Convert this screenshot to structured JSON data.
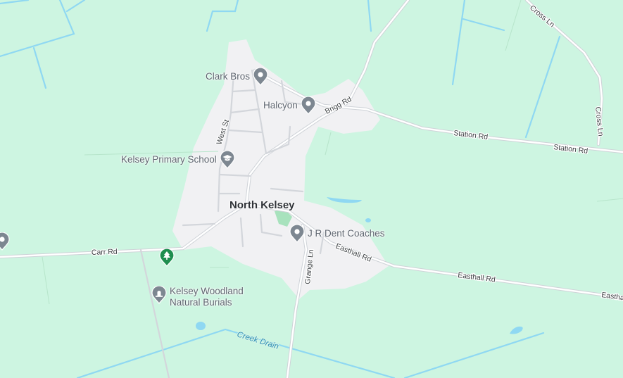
{
  "map": {
    "place": "North Kelsey",
    "pois": [
      {
        "name": "Clark Bros",
        "icon": "map-pin-icon"
      },
      {
        "name": "Halcyon",
        "icon": "map-pin-icon"
      },
      {
        "name": "Kelsey Primary School",
        "icon": "school-icon"
      },
      {
        "name": "J R Dent Coaches",
        "icon": "map-pin-icon"
      },
      {
        "name": "Kelsey Woodland\nNatural Burials",
        "icon": "cemetery-icon"
      },
      {
        "name": "",
        "icon": "park-tree-icon"
      },
      {
        "name": "",
        "icon": "map-pin-icon"
      }
    ],
    "roads": {
      "cross_ln_1": "Cross Ln",
      "cross_ln_2": "Cross Ln",
      "brigg_rd": "Brigg Rd",
      "station_rd_1": "Station Rd",
      "station_rd_2": "Station Rd",
      "west_st": "West St",
      "carr_rd": "Carr Rd",
      "grange_ln": "Grange Ln",
      "easthall_rd_1": "Easthall Rd",
      "easthall_rd_2": "Easthall Rd",
      "easthall_rd_3": "Eastha"
    },
    "water": {
      "creek_drain": "Creek Drain"
    },
    "colors": {
      "land": "#cdf5e1",
      "settlement": "#f1f1f3",
      "water": "#8fd8f2",
      "road": "#ffffff",
      "road_outline": "#cfd3d8",
      "pin": "#7d8791",
      "park_pin": "#1e8e4f"
    }
  }
}
